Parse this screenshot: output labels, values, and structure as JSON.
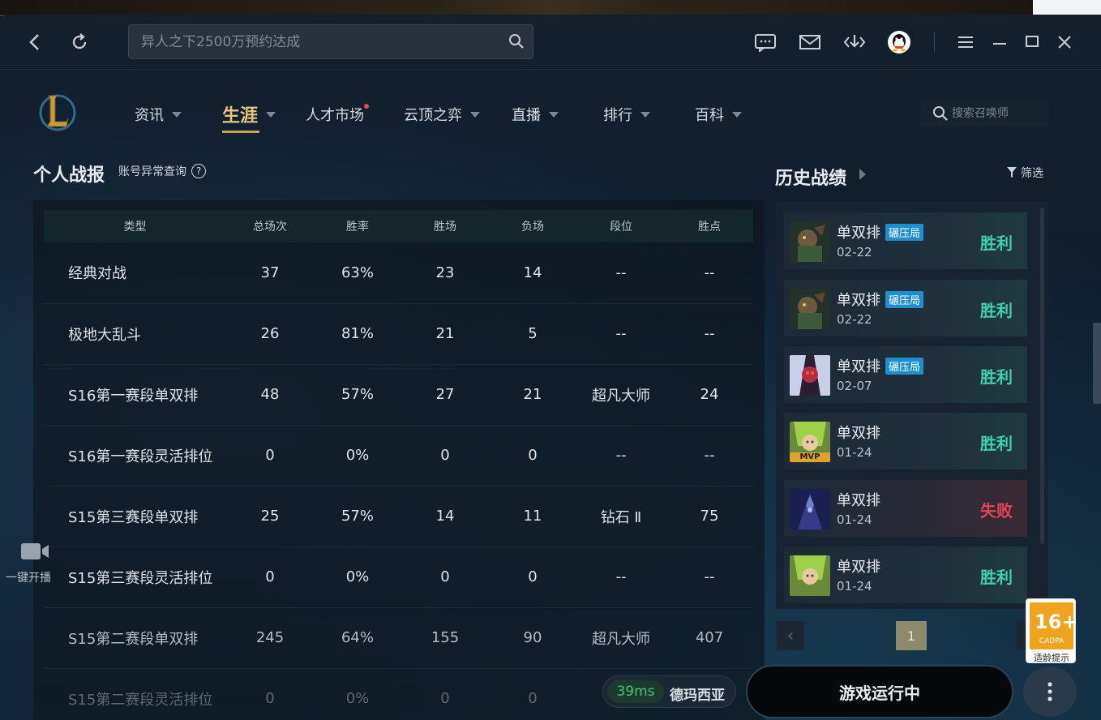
{
  "titlebar": {
    "search_placeholder": "异人之下2500万预约达成",
    "icons": [
      "back-icon",
      "refresh-icon",
      "search-icon",
      "chat-icon",
      "mail-icon",
      "download-icon",
      "qq-avatar",
      "menu-icon",
      "minimize-icon",
      "maximize-icon",
      "close-icon"
    ]
  },
  "nav": {
    "items": [
      {
        "label": "资讯"
      },
      {
        "label": "生涯"
      },
      {
        "label": "人才市场"
      },
      {
        "label": "云顶之弈"
      },
      {
        "label": "直播"
      },
      {
        "label": "排行"
      },
      {
        "label": "百科"
      }
    ],
    "summoner_search_placeholder": "搜索召唤师"
  },
  "stats": {
    "title": "个人战报",
    "abnormal_link": "账号异常查询",
    "qmark": "?",
    "headers": [
      "类型",
      "总场次",
      "胜率",
      "胜场",
      "负场",
      "段位",
      "胜点"
    ],
    "rows": [
      [
        "经典对战",
        "37",
        "63%",
        "23",
        "14",
        "--",
        "--"
      ],
      [
        "极地大乱斗",
        "26",
        "81%",
        "21",
        "5",
        "--",
        "--"
      ],
      [
        "S16第一赛段单双排",
        "48",
        "57%",
        "27",
        "21",
        "超凡大师",
        "24"
      ],
      [
        "S16第一赛段灵活排位",
        "0",
        "0%",
        "0",
        "0",
        "--",
        "--"
      ],
      [
        "S15第三赛段单双排",
        "25",
        "57%",
        "14",
        "11",
        "钻石 Ⅱ",
        "75"
      ],
      [
        "S15第三赛段灵活排位",
        "0",
        "0%",
        "0",
        "0",
        "--",
        "--"
      ],
      [
        "S15第二赛段单双排",
        "245",
        "64%",
        "155",
        "90",
        "超凡大师",
        "407"
      ],
      [
        "S15第二赛段灵活排位",
        "0",
        "0%",
        "0",
        "0",
        "",
        ""
      ]
    ]
  },
  "side": {
    "live_label": "一键开播"
  },
  "history": {
    "title": "历史战绩",
    "filter": "筛选",
    "matches": [
      {
        "mode": "单双排",
        "badge": "碾压局",
        "date": "02-22",
        "result": "胜利",
        "color": "#3fd0b0"
      },
      {
        "mode": "单双排",
        "badge": "碾压局",
        "date": "02-22",
        "result": "胜利",
        "color": "#3fd0b0"
      },
      {
        "mode": "单双排",
        "badge": "碾压局",
        "date": "02-07",
        "result": "胜利",
        "color": "#3fd0b0"
      },
      {
        "mode": "单双排",
        "badge": "",
        "date": "01-24",
        "result": "胜利",
        "color": "#3fd0b0",
        "mvp": "MVP"
      },
      {
        "mode": "单双排",
        "badge": "",
        "date": "01-24",
        "result": "失败",
        "color": "#e0455a"
      },
      {
        "mode": "单双排",
        "badge": "",
        "date": "01-24",
        "result": "胜利",
        "color": "#3fd0b0"
      }
    ],
    "page": "1",
    "prev": "‹"
  },
  "age_rating": {
    "num": "16+",
    "org": "CADPA",
    "text": "适龄提示"
  },
  "footer": {
    "ping": "39ms",
    "server": "德玛西亚",
    "play_button": "游戏运行中"
  },
  "colors": {
    "accent_gold": "#c9a35a",
    "win": "#3fd0b0",
    "loss": "#e0455a"
  }
}
